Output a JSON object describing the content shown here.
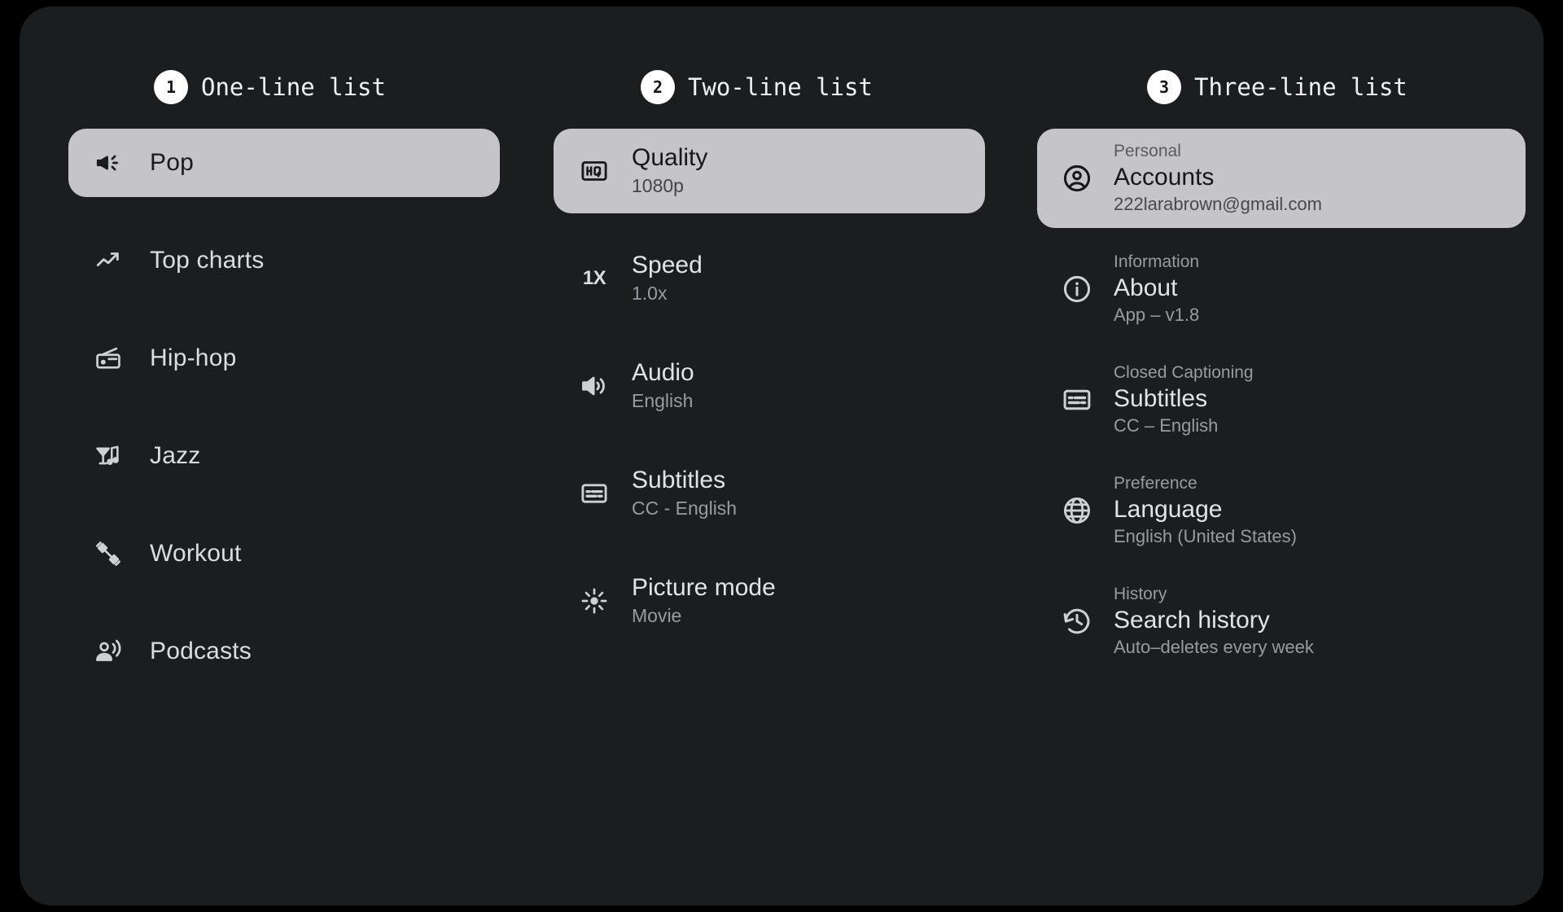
{
  "theme": {
    "page_background": "#000000",
    "panel_background": "#1c1d1f",
    "selected_background": "#c4c4c9",
    "primary_text": "#e2e3e6",
    "secondary_text": "#9a9ba0",
    "selected_primary_text": "#16171a",
    "badge_background": "#ffffff"
  },
  "columns": [
    {
      "badge": "1",
      "title": "One-line list",
      "items": [
        {
          "icon": "campaign-icon",
          "label": "Pop",
          "selected": true
        },
        {
          "icon": "trending-up-icon",
          "label": "Top charts",
          "selected": false
        },
        {
          "icon": "radio-icon",
          "label": "Hip-hop",
          "selected": false
        },
        {
          "icon": "nightlife-icon",
          "label": "Jazz",
          "selected": false
        },
        {
          "icon": "dumbbell-icon",
          "label": "Workout",
          "selected": false
        },
        {
          "icon": "podcasts-icon",
          "label": "Podcasts",
          "selected": false
        }
      ]
    },
    {
      "badge": "2",
      "title": "Two-line list",
      "items": [
        {
          "icon": "hq-icon",
          "title": "Quality",
          "subtitle": "1080p",
          "selected": true
        },
        {
          "icon": "speed-1x-icon",
          "title": "Speed",
          "subtitle": "1.0x",
          "selected": false,
          "icon_text": "1X"
        },
        {
          "icon": "volume-up-icon",
          "title": "Audio",
          "subtitle": "English",
          "selected": false
        },
        {
          "icon": "subtitles-icon",
          "title": "Subtitles",
          "subtitle": "CC - English",
          "selected": false
        },
        {
          "icon": "brightness-icon",
          "title": "Picture mode",
          "subtitle": "Movie",
          "selected": false
        }
      ]
    },
    {
      "badge": "3",
      "title": "Three-line list",
      "items": [
        {
          "icon": "account-circle-icon",
          "overline": "Personal",
          "title": "Accounts",
          "subtitle": "222larabrown@gmail.com",
          "selected": true
        },
        {
          "icon": "info-icon",
          "overline": "Information",
          "title": "About",
          "subtitle": "App – v1.8",
          "selected": false
        },
        {
          "icon": "subtitles-icon",
          "overline": "Closed Captioning",
          "title": "Subtitles",
          "subtitle": "CC – English",
          "selected": false
        },
        {
          "icon": "globe-icon",
          "overline": "Preference",
          "title": "Language",
          "subtitle": "English (United States)",
          "selected": false
        },
        {
          "icon": "history-icon",
          "overline": "History",
          "title": "Search history",
          "subtitle": "Auto–deletes every week",
          "selected": false
        }
      ]
    }
  ]
}
